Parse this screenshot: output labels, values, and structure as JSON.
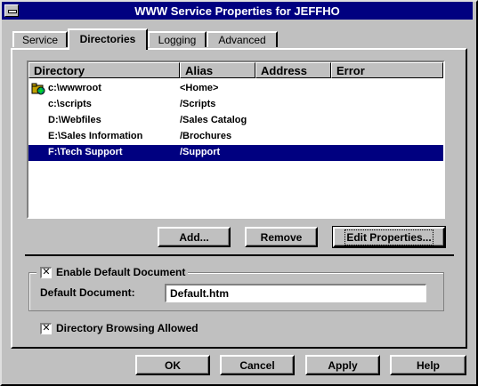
{
  "window": {
    "title": "WWW Service Properties for JEFFHO"
  },
  "tabs": [
    {
      "label": "Service"
    },
    {
      "label": "Directories"
    },
    {
      "label": "Logging"
    },
    {
      "label": "Advanced"
    }
  ],
  "active_tab": "Directories",
  "list": {
    "columns": [
      {
        "label": "Directory"
      },
      {
        "label": "Alias"
      },
      {
        "label": "Address"
      },
      {
        "label": "Error"
      }
    ],
    "rows": [
      {
        "directory": "c:\\wwwroot",
        "alias": "<Home>",
        "address": "",
        "error": "",
        "icon": "folder-icon",
        "selected": false
      },
      {
        "directory": "c:\\scripts",
        "alias": "/Scripts",
        "address": "",
        "error": "",
        "selected": false
      },
      {
        "directory": "D:\\Webfiles",
        "alias": "/Sales Catalog",
        "address": "",
        "error": "",
        "selected": false
      },
      {
        "directory": "E:\\Sales Information",
        "alias": "/Brochures",
        "address": "",
        "error": "",
        "selected": false
      },
      {
        "directory": "F:\\Tech Support",
        "alias": "/Support",
        "address": "",
        "error": "",
        "selected": true
      }
    ]
  },
  "list_buttons": {
    "add": "Add...",
    "remove": "Remove",
    "edit": "Edit Properties..."
  },
  "default_document": {
    "enable_label": "Enable Default Document",
    "enabled": true,
    "field_label": "Default Document:",
    "value": "Default.htm"
  },
  "directory_browsing": {
    "label": "Directory Browsing Allowed",
    "enabled": true
  },
  "dialog_buttons": {
    "ok": "OK",
    "cancel": "Cancel",
    "apply": "Apply",
    "help": "Help"
  },
  "colors": {
    "selection": "#000080",
    "face": "#c0c0c0",
    "titlebar": "#000080"
  }
}
